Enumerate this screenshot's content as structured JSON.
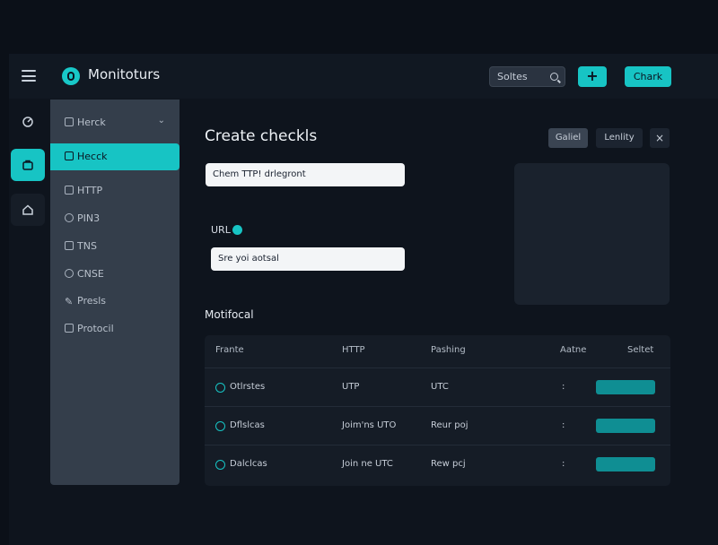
{
  "header": {
    "app_title": "Monitoturs",
    "search_label": "Soltes",
    "plus_label": "+",
    "check_label": "Chark"
  },
  "rail": {
    "icons": [
      "gauge-icon",
      "briefcase-icon",
      "home-icon"
    ]
  },
  "sidebar": {
    "items": [
      {
        "label": "Herck",
        "icon": "lock-icon"
      },
      {
        "label": "Hecck",
        "icon": "lock-icon"
      },
      {
        "label": "HTTP",
        "icon": "grid-icon"
      },
      {
        "label": "PIN3",
        "icon": "gear-icon"
      },
      {
        "label": "TNS",
        "icon": "link-icon"
      },
      {
        "label": "CNSE",
        "icon": "shield-icon"
      },
      {
        "label": "Presls",
        "icon": "pen-icon"
      },
      {
        "label": "Protocil",
        "icon": "box-icon"
      }
    ]
  },
  "main": {
    "title": "Create checkls",
    "chips": {
      "gallery": "Galiel",
      "lendity": "Lenlity",
      "close": "×"
    },
    "name_input_value": "Chem TTP! drlegront",
    "url_label": "URL",
    "url_input_value": "Sre yoi aotsal",
    "section_title": "Motifocal",
    "table": {
      "headers": [
        "Frante",
        "HTTP",
        "Pashing",
        "Aatne",
        "Seltet"
      ],
      "rows": [
        {
          "name": "Otlrstes",
          "http": "UTP",
          "pashing": "UTC",
          "aatne": ":",
          "toggle": 0.6
        },
        {
          "name": "Dflslcas",
          "http": "Joim'ns UTO",
          "pashing": "Reur poj",
          "aatne": ":",
          "toggle": 0.55
        },
        {
          "name": "Dalclcas",
          "http": "Join ne UTC",
          "pashing": "Rew pcj",
          "aatne": ":",
          "toggle": 0.5
        }
      ]
    }
  }
}
